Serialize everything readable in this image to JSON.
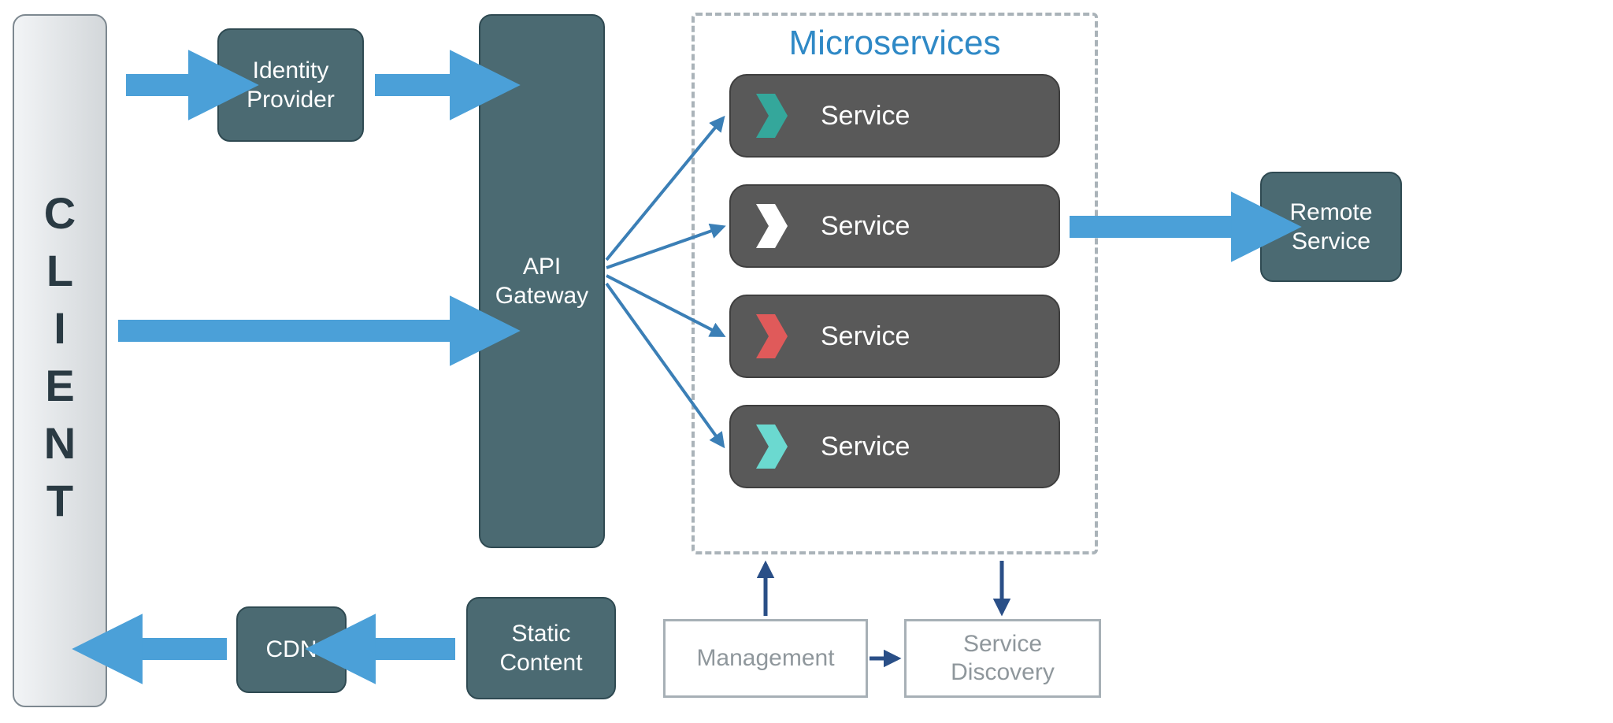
{
  "client": {
    "label": "CLIENT"
  },
  "identity_provider": {
    "label": "Identity\nProvider"
  },
  "api_gateway": {
    "label": "API\nGateway"
  },
  "cdn": {
    "label": "CDN"
  },
  "static_content": {
    "label": "Static\nContent"
  },
  "remote_service": {
    "label": "Remote\nService"
  },
  "microservices": {
    "title": "Microservices",
    "services": [
      {
        "label": "Service",
        "chevron_color": "#34a79b"
      },
      {
        "label": "Service",
        "chevron_color": "#ffffff"
      },
      {
        "label": "Service",
        "chevron_color": "#e05a5a"
      },
      {
        "label": "Service",
        "chevron_color": "#6bd9d0"
      }
    ]
  },
  "management": {
    "label": "Management"
  },
  "service_discovery": {
    "label": "Service\nDiscovery"
  },
  "colors": {
    "thick_arrow": "#4ba0d8",
    "thin_arrow": "#3b7fb6",
    "dark_arrow": "#2a4f87"
  }
}
